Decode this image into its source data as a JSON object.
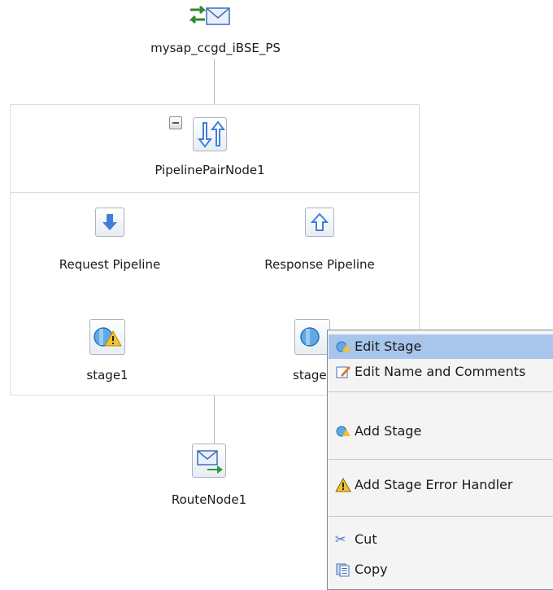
{
  "diagram": {
    "service_node": {
      "label": "mysap_ccgd_iBSE_PS",
      "icon": "proxy-service-icon"
    },
    "pipeline_pair": {
      "label": "PipelinePairNode1",
      "icon": "pipeline-pair-icon"
    },
    "request_pipeline": {
      "label": "Request Pipeline",
      "icon": "arrow-down-icon"
    },
    "response_pipeline": {
      "label": "Response Pipeline",
      "icon": "arrow-up-icon"
    },
    "stage1": {
      "label": "stage1",
      "icon": "stage-warning-icon"
    },
    "stage2": {
      "label": "stage",
      "icon": "stage-icon"
    },
    "route_node": {
      "label": "RouteNode1",
      "icon": "route-node-icon"
    }
  },
  "context_menu": {
    "items": [
      {
        "label": "Edit Stage",
        "icon": "stage-icon",
        "highlighted": true
      },
      {
        "label": "Edit Name and Comments",
        "icon": "edit-icon"
      },
      {
        "label": "Add Stage",
        "icon": "stage-icon"
      },
      {
        "label": "Add Stage Error Handler",
        "icon": "warning-icon"
      },
      {
        "label": "Cut",
        "icon": "scissors-icon"
      },
      {
        "label": "Copy",
        "icon": "copy-icon"
      }
    ]
  },
  "colors": {
    "menu_highlight": "#a8c6ec",
    "connector": "#b9b9b9",
    "arrow_blue": "#3f7fd8"
  }
}
